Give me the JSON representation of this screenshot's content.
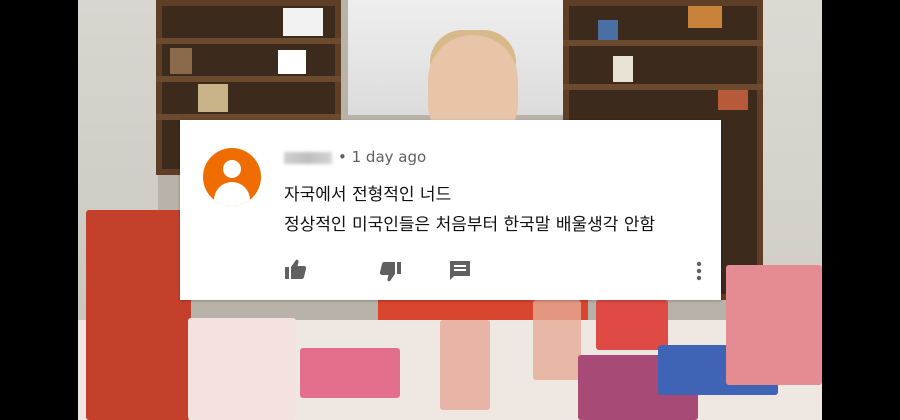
{
  "comment": {
    "author": "",
    "time_label": "• 1 day ago",
    "lines": [
      "자국에서 전형적인 너드",
      "정상적인 미국인들은 처음부터 한국말 배울생각 안함"
    ]
  },
  "actions": {
    "like_icon": "thumb-up-icon",
    "dislike_icon": "thumb-down-icon",
    "reply_icon": "reply-comment-icon",
    "more_icon": "more-vertical-icon"
  },
  "colors": {
    "avatar": "#ef6c00",
    "icon": "#606060",
    "meta_text": "#606060",
    "body_text": "#111111",
    "card": "#ffffff",
    "letterbox": "#000000"
  }
}
